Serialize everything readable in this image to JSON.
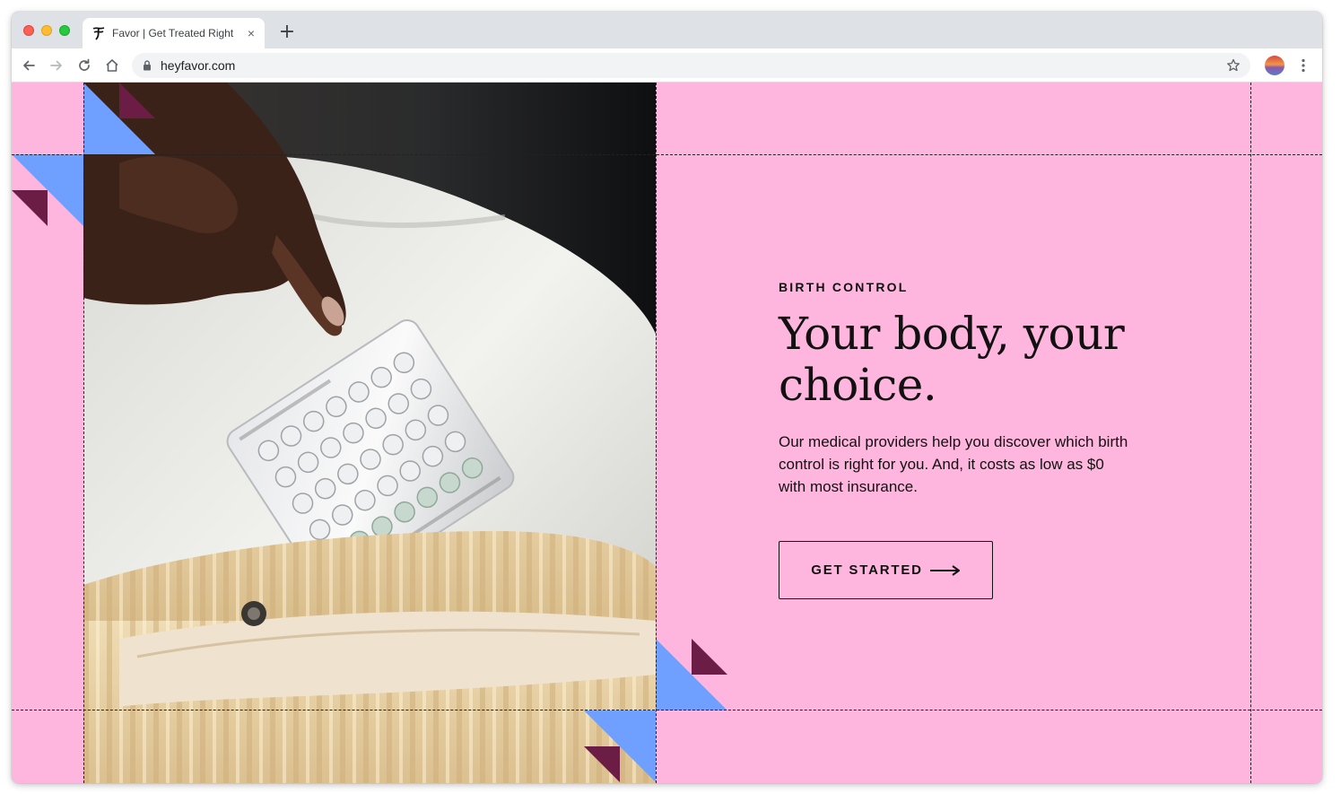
{
  "browser": {
    "tab_title": "Favor | Get Treated Right",
    "url": "heyfavor.com",
    "close_glyph": "×",
    "newtab_glyph": "+"
  },
  "icons": {
    "back": "arrow-left-icon",
    "forward": "arrow-right-icon",
    "reload": "reload-icon",
    "home": "home-icon",
    "lock": "lock-icon",
    "bookmark": "star-icon",
    "menu": "kebab-menu-icon",
    "favicon": "favor-logo-icon",
    "cta_arrow": "long-arrow-right-icon"
  },
  "hero": {
    "eyebrow": "BIRTH CONTROL",
    "headline_line1": "Your body, your",
    "headline_line2": "choice.",
    "body_line1": "Our medical providers help you discover which birth",
    "body_line2": "control is right for you. And, it costs as low as $0",
    "body_line3": "with most insurance.",
    "cta_label": "GET STARTED"
  },
  "colors": {
    "page_background": "#ffb6de",
    "accent_blue": "#6fa0ff",
    "accent_plum": "#6b1d45",
    "text": "#111111"
  }
}
